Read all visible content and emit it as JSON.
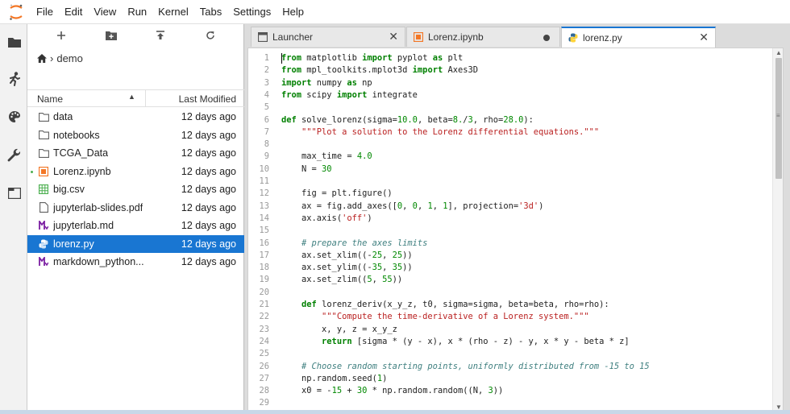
{
  "menubar": {
    "items": [
      "File",
      "Edit",
      "View",
      "Run",
      "Kernel",
      "Tabs",
      "Settings",
      "Help"
    ]
  },
  "activity_icons": [
    "folder-icon",
    "running-icon",
    "palette-icon",
    "wrench-icon",
    "tabs-icon"
  ],
  "filebrowser": {
    "toolbar_icons": [
      "new-launcher-icon",
      "new-folder-icon",
      "upload-icon",
      "refresh-icon"
    ],
    "breadcrumb": {
      "home_icon": "home-icon",
      "separator": "›",
      "folder": "demo"
    },
    "columns": {
      "name": "Name",
      "modified": "Last Modified"
    },
    "files": [
      {
        "name": "data",
        "modified": "12 days ago",
        "icon": "folder-icon",
        "running": false,
        "selected": false
      },
      {
        "name": "notebooks",
        "modified": "12 days ago",
        "icon": "folder-icon",
        "running": false,
        "selected": false
      },
      {
        "name": "TCGA_Data",
        "modified": "12 days ago",
        "icon": "folder-icon",
        "running": false,
        "selected": false
      },
      {
        "name": "Lorenz.ipynb",
        "modified": "12 days ago",
        "icon": "notebook-icon",
        "running": true,
        "selected": false
      },
      {
        "name": "big.csv",
        "modified": "12 days ago",
        "icon": "spreadsheet-icon",
        "running": false,
        "selected": false
      },
      {
        "name": "jupyterlab-slides.pdf",
        "modified": "12 days ago",
        "icon": "file-icon",
        "running": false,
        "selected": false
      },
      {
        "name": "jupyterlab.md",
        "modified": "12 days ago",
        "icon": "markdown-icon",
        "running": false,
        "selected": false
      },
      {
        "name": "lorenz.py",
        "modified": "12 days ago",
        "icon": "python-icon",
        "running": false,
        "selected": true
      },
      {
        "name": "markdown_python....",
        "modified": "12 days ago",
        "icon": "markdown-icon",
        "running": false,
        "selected": false
      }
    ]
  },
  "tabs": [
    {
      "label": "Launcher",
      "icon": "launcher-icon",
      "active": false,
      "dirty": false
    },
    {
      "label": "Lorenz.ipynb",
      "icon": "notebook-icon",
      "active": false,
      "dirty": true
    },
    {
      "label": "lorenz.py",
      "icon": "python-icon",
      "active": true,
      "dirty": false
    }
  ],
  "editor": {
    "lines": [
      "from matplotlib import pyplot as plt",
      "from mpl_toolkits.mplot3d import Axes3D",
      "import numpy as np",
      "from scipy import integrate",
      "",
      "def solve_lorenz(sigma=10.0, beta=8./3, rho=28.0):",
      "    \"\"\"Plot a solution to the Lorenz differential equations.\"\"\"",
      "",
      "    max_time = 4.0",
      "    N = 30",
      "",
      "    fig = plt.figure()",
      "    ax = fig.add_axes([0, 0, 1, 1], projection='3d')",
      "    ax.axis('off')",
      "",
      "    # prepare the axes limits",
      "    ax.set_xlim((-25, 25))",
      "    ax.set_ylim((-35, 35))",
      "    ax.set_zlim((5, 55))",
      "",
      "    def lorenz_deriv(x_y_z, t0, sigma=sigma, beta=beta, rho=rho):",
      "        \"\"\"Compute the time-derivative of a Lorenz system.\"\"\"",
      "        x, y, z = x_y_z",
      "        return [sigma * (y - x), x * (rho - z) - y, x * y - beta * z]",
      "",
      "    # Choose random starting points, uniformly distributed from -15 to 15",
      "    np.random.seed(1)",
      "    x0 = -15 + 30 * np.random.random((N, 3))",
      ""
    ]
  },
  "colors": {
    "accent": "#1976d2",
    "keyword": "#008000",
    "string": "#ba2121",
    "comment": "#408080",
    "number": "#008800",
    "notebook_orange": "#f37726",
    "markdown_purple": "#7b1fa2",
    "csv_green": "#4caf50"
  }
}
